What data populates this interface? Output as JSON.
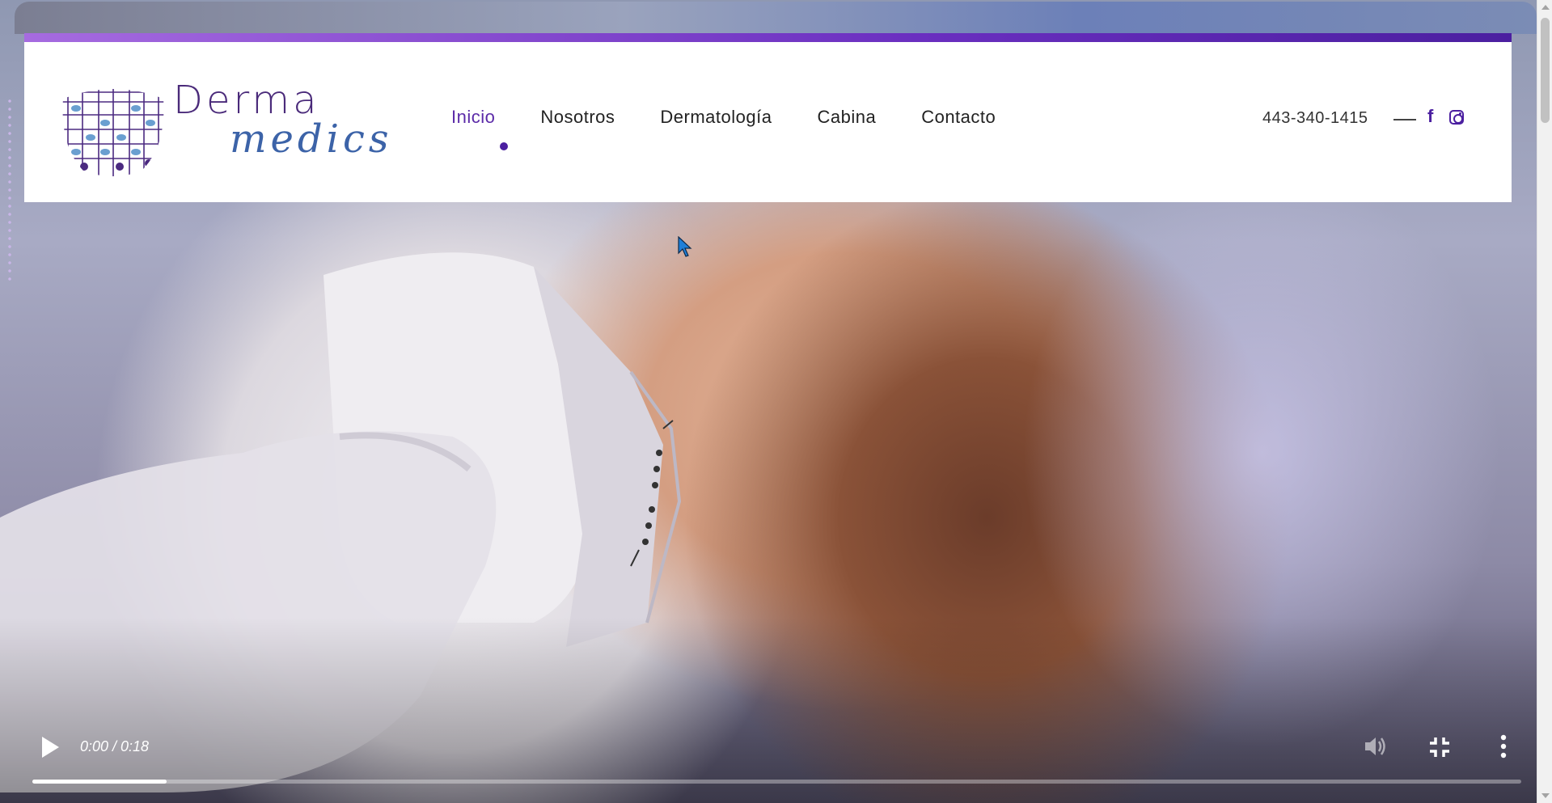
{
  "brand": {
    "line1": "Derma",
    "line2": "medics"
  },
  "nav": {
    "items": [
      {
        "label": "Inicio",
        "active": true
      },
      {
        "label": "Nosotros",
        "active": false
      },
      {
        "label": "Dermatología",
        "active": false
      },
      {
        "label": "Cabina",
        "active": false
      },
      {
        "label": "Contacto",
        "active": false
      }
    ]
  },
  "contact": {
    "phone": "443-340-1415",
    "social": [
      "facebook-icon",
      "instagram-icon"
    ]
  },
  "video": {
    "time": "0:00 / 0:18",
    "progress_fraction": 0.09,
    "controls": [
      "play-icon",
      "volume-icon",
      "exit-fullscreen-icon",
      "more-vert-icon"
    ]
  },
  "colors": {
    "accent": "#4b1fa0",
    "accent_light": "#a66be0",
    "logo_blue": "#3c63a8"
  }
}
